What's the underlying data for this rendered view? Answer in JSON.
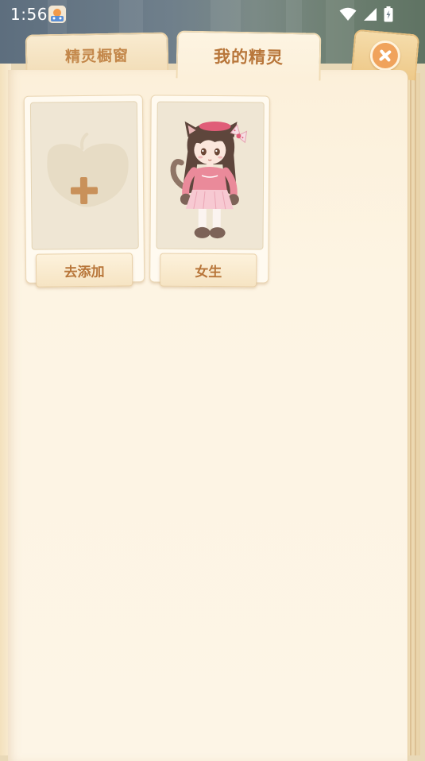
{
  "status_bar": {
    "time": "1:56"
  },
  "tabs": {
    "showcase_label": "精灵橱窗",
    "my_sprites_label": "我的精灵"
  },
  "cards": [
    {
      "button_label": "去添加",
      "icon": "add-plus-icon"
    },
    {
      "button_label": "女生",
      "icon": "girl-cat-character"
    }
  ],
  "colors": {
    "tab_text": "#c3874a",
    "active_tab_text": "#b8763a",
    "close_button": "#f0a35c",
    "page_background": "#fdf4e3",
    "card_placeholder": "#efe6d4"
  }
}
